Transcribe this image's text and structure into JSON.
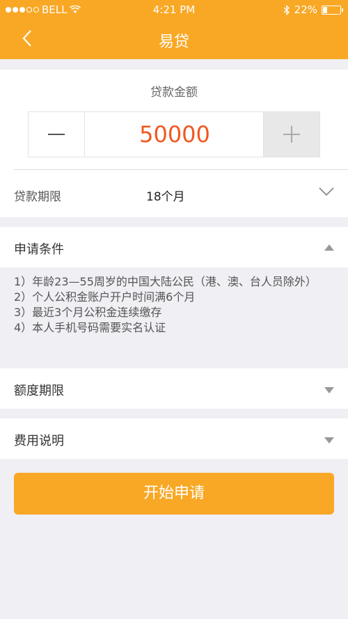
{
  "status_bar": {
    "carrier": "BELL",
    "time": "4:21 PM",
    "battery": "22%"
  },
  "nav": {
    "title": "易贷"
  },
  "loan": {
    "amount_label": "贷款金额",
    "amount_value": "50000",
    "term_label": "贷款期限",
    "term_value": "18个月"
  },
  "sections": {
    "conditions": {
      "title": "申请条件",
      "items": [
        "1）年龄23—55周岁的中国大陆公民（港、澳、台人员除外）",
        "2）个人公积金账户开户时间满6个月",
        "3）最近3个月公积金连续缴存",
        "4）本人手机号码需要实名认证"
      ]
    },
    "limit": {
      "title": "额度期限"
    },
    "fees": {
      "title": "费用说明"
    }
  },
  "apply_button": "开始申请",
  "colors": {
    "primary": "#f9a825",
    "amount_text": "#f0581f",
    "background": "#efeff4"
  }
}
